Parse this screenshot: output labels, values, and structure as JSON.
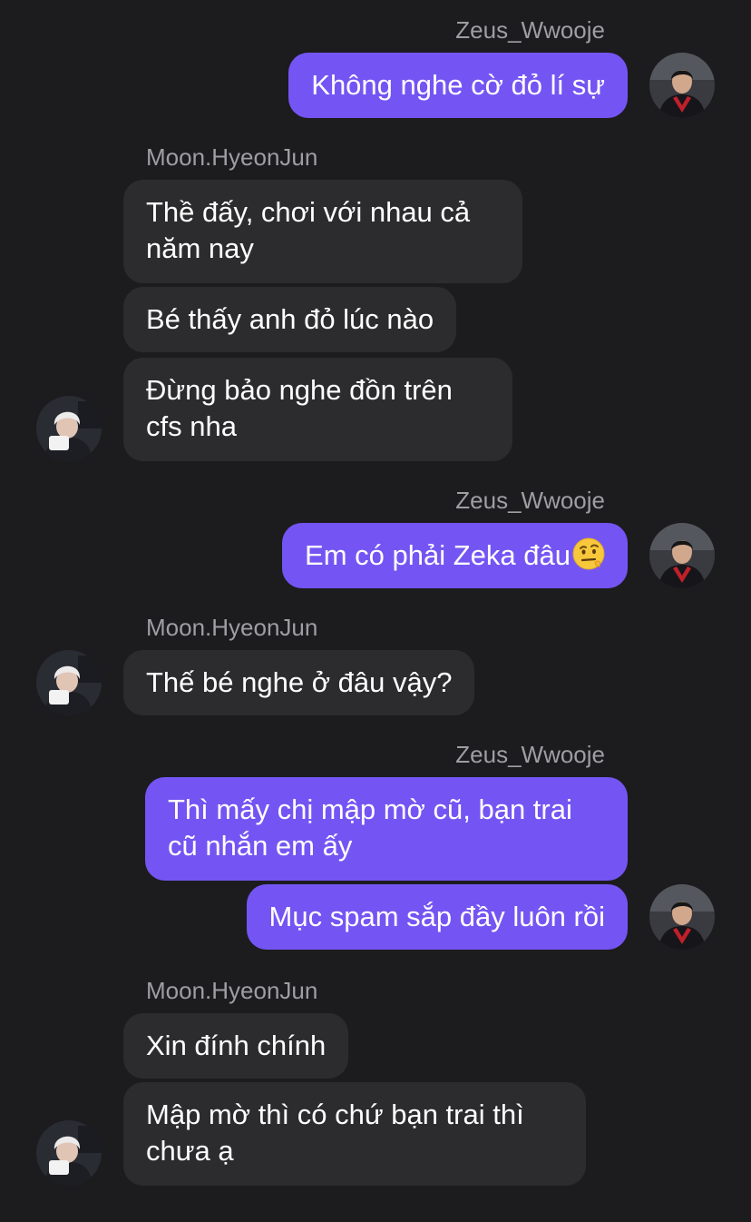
{
  "chat": {
    "sender_zeus": "Zeus_Wwooje",
    "sender_moon": "Moon.HyeonJun",
    "group1": {
      "name": "Zeus_Wwooje",
      "msg1": "Không nghe cờ đỏ lí sự"
    },
    "group2": {
      "name": "Moon.HyeonJun",
      "msg1": "Thề đấy, chơi với nhau cả năm nay",
      "msg2": "Bé thấy anh đỏ lúc nào",
      "msg3": "Đừng bảo nghe đồn trên cfs nha"
    },
    "group3": {
      "name": "Zeus_Wwooje",
      "msg1": "Em có phải Zeka đâu",
      "msg1_emoji": "face-with-raised-eyebrow-emoji"
    },
    "group4": {
      "name": "Moon.HyeonJun",
      "msg1": "Thế bé nghe ở đâu vậy?"
    },
    "group5": {
      "name": "Zeus_Wwooje",
      "msg1": "Thì mấy chị mập mờ cũ, bạn trai cũ nhắn em ấy",
      "msg2": "Mục spam sắp đầy luôn rồi"
    },
    "group6": {
      "name": "Moon.HyeonJun",
      "msg1": "Xin đính chính",
      "msg2": "Mập mờ thì có chứ bạn trai thì chưa ạ"
    }
  },
  "colors": {
    "background": "#1c1c1e",
    "outgoing_bubble": "#7455f3",
    "incoming_bubble": "#2c2c2e",
    "sender_name": "#9e9ea3",
    "text": "#ffffff"
  }
}
